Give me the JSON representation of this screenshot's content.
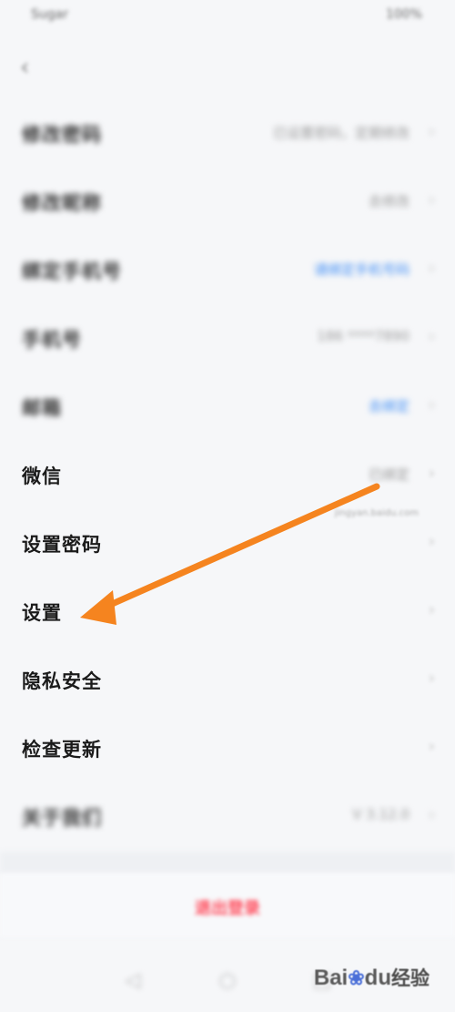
{
  "status_bar": {
    "left": "Sugar",
    "right": "100%"
  },
  "back_icon": "chevron-left-icon",
  "rows": [
    {
      "label": "修改密码",
      "value": "已设置密码，定期修改",
      "value_style": "gray"
    },
    {
      "label": "修改昵称",
      "value": "去修改",
      "value_style": "gray"
    },
    {
      "label": "绑定手机号",
      "value": "请绑定手机号码",
      "value_style": "blue"
    },
    {
      "label": "手机号",
      "value": "186 ****7890",
      "value_style": "gray"
    },
    {
      "label": "邮箱",
      "value": "去绑定",
      "value_style": "blue"
    },
    {
      "label": "微信",
      "value": "已绑定",
      "value_style": "gray"
    },
    {
      "label": "设置密码",
      "value": "",
      "value_style": "gray"
    },
    {
      "label": "设置",
      "value": "",
      "value_style": "gray"
    },
    {
      "label": "隐私安全",
      "value": "",
      "value_style": "gray"
    },
    {
      "label": "检查更新",
      "value": "",
      "value_style": "gray"
    },
    {
      "label": "关于我们",
      "value": "V 3.12.0",
      "value_style": "gray"
    }
  ],
  "logout_label": "退出登录",
  "chevron": "›",
  "watermark": {
    "brand": "Bai",
    "brand_suffix": "du",
    "product": "经验",
    "url": "jingyan.baidu.com"
  },
  "arrow_color": "#f5841f",
  "nav_icons": [
    "back-triangle-icon",
    "home-circle-icon",
    "recent-square-icon"
  ]
}
